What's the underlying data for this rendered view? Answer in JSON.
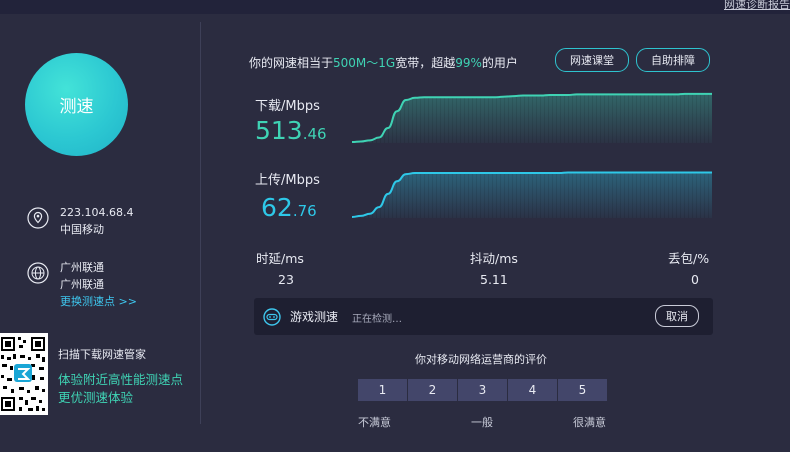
{
  "top_link": "网速诊断报告",
  "test_button": {
    "label": "测速"
  },
  "location": {
    "ip": "223.104.68.4",
    "carrier": "中国移动"
  },
  "node": {
    "line1": "广州联通",
    "line2": "广州联通",
    "change_label": "更换测速点 >>"
  },
  "qr": {
    "title": "扫描下载网速管家",
    "promo1": "体验附近高性能测速点",
    "promo2": "更优测速体验"
  },
  "summary": {
    "prefix": "你的网速相当于",
    "bandwidth": "500M～1G",
    "mid": "宽带，超越",
    "percent": "99%",
    "suffix": "的用户"
  },
  "buttons": {
    "course": "网速课堂",
    "diagnose": "自助排障"
  },
  "download": {
    "label": "下载/Mbps",
    "int": "513",
    "frac": ".46",
    "trace": [
      0.0,
      0.01,
      0.03,
      0.08,
      0.25,
      0.55,
      0.75,
      0.79,
      0.8,
      0.8,
      0.8,
      0.8,
      0.8,
      0.8,
      0.8,
      0.8,
      0.8,
      0.81,
      0.82,
      0.83,
      0.83,
      0.83,
      0.84,
      0.84,
      0.84,
      0.85,
      0.85,
      0.85,
      0.85,
      0.85,
      0.85,
      0.85,
      0.85,
      0.85,
      0.85,
      0.85,
      0.85,
      0.86,
      0.86,
      0.86,
      0.86
    ]
  },
  "upload": {
    "label": "上传/Mbps",
    "int": "62",
    "frac": ".76",
    "trace": [
      0.0,
      0.02,
      0.06,
      0.18,
      0.42,
      0.65,
      0.78,
      0.8,
      0.8,
      0.8,
      0.8,
      0.8,
      0.8,
      0.8,
      0.8,
      0.8,
      0.8,
      0.8,
      0.8,
      0.8,
      0.8,
      0.8,
      0.8,
      0.8,
      0.81,
      0.81,
      0.81,
      0.81,
      0.81,
      0.81,
      0.81,
      0.81,
      0.81,
      0.81,
      0.81,
      0.81,
      0.81,
      0.81,
      0.81,
      0.81,
      0.81
    ]
  },
  "stats": {
    "latency_label": "时延/ms",
    "latency": "23",
    "jitter_label": "抖动/ms",
    "jitter": "5.11",
    "loss_label": "丢包/%",
    "loss": "0"
  },
  "game": {
    "title": "游戏测速",
    "status": "正在检测…",
    "cancel": "取消"
  },
  "rating": {
    "title": "你对移动网络运营商的评价",
    "options": [
      "1",
      "2",
      "3",
      "4",
      "5"
    ],
    "low": "不满意",
    "mid": "一般",
    "high": "很满意"
  },
  "colors": {
    "accent_green": "#3fd3b4",
    "accent_blue": "#2ec8e8",
    "background": "#2b2c40"
  }
}
